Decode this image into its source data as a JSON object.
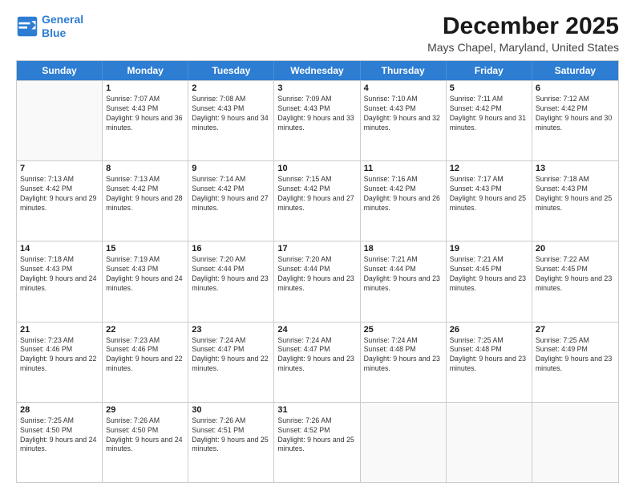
{
  "header": {
    "logo_line1": "General",
    "logo_line2": "Blue",
    "title": "December 2025",
    "subtitle": "Mays Chapel, Maryland, United States"
  },
  "calendar": {
    "days": [
      "Sunday",
      "Monday",
      "Tuesday",
      "Wednesday",
      "Thursday",
      "Friday",
      "Saturday"
    ],
    "rows": [
      [
        {
          "date": "",
          "sunrise": "",
          "sunset": "",
          "daylight": "",
          "empty": true
        },
        {
          "date": "1",
          "sunrise": "Sunrise: 7:07 AM",
          "sunset": "Sunset: 4:43 PM",
          "daylight": "Daylight: 9 hours and 36 minutes.",
          "empty": false
        },
        {
          "date": "2",
          "sunrise": "Sunrise: 7:08 AM",
          "sunset": "Sunset: 4:43 PM",
          "daylight": "Daylight: 9 hours and 34 minutes.",
          "empty": false
        },
        {
          "date": "3",
          "sunrise": "Sunrise: 7:09 AM",
          "sunset": "Sunset: 4:43 PM",
          "daylight": "Daylight: 9 hours and 33 minutes.",
          "empty": false
        },
        {
          "date": "4",
          "sunrise": "Sunrise: 7:10 AM",
          "sunset": "Sunset: 4:43 PM",
          "daylight": "Daylight: 9 hours and 32 minutes.",
          "empty": false
        },
        {
          "date": "5",
          "sunrise": "Sunrise: 7:11 AM",
          "sunset": "Sunset: 4:42 PM",
          "daylight": "Daylight: 9 hours and 31 minutes.",
          "empty": false
        },
        {
          "date": "6",
          "sunrise": "Sunrise: 7:12 AM",
          "sunset": "Sunset: 4:42 PM",
          "daylight": "Daylight: 9 hours and 30 minutes.",
          "empty": false
        }
      ],
      [
        {
          "date": "7",
          "sunrise": "Sunrise: 7:13 AM",
          "sunset": "Sunset: 4:42 PM",
          "daylight": "Daylight: 9 hours and 29 minutes.",
          "empty": false
        },
        {
          "date": "8",
          "sunrise": "Sunrise: 7:13 AM",
          "sunset": "Sunset: 4:42 PM",
          "daylight": "Daylight: 9 hours and 28 minutes.",
          "empty": false
        },
        {
          "date": "9",
          "sunrise": "Sunrise: 7:14 AM",
          "sunset": "Sunset: 4:42 PM",
          "daylight": "Daylight: 9 hours and 27 minutes.",
          "empty": false
        },
        {
          "date": "10",
          "sunrise": "Sunrise: 7:15 AM",
          "sunset": "Sunset: 4:42 PM",
          "daylight": "Daylight: 9 hours and 27 minutes.",
          "empty": false
        },
        {
          "date": "11",
          "sunrise": "Sunrise: 7:16 AM",
          "sunset": "Sunset: 4:42 PM",
          "daylight": "Daylight: 9 hours and 26 minutes.",
          "empty": false
        },
        {
          "date": "12",
          "sunrise": "Sunrise: 7:17 AM",
          "sunset": "Sunset: 4:43 PM",
          "daylight": "Daylight: 9 hours and 25 minutes.",
          "empty": false
        },
        {
          "date": "13",
          "sunrise": "Sunrise: 7:18 AM",
          "sunset": "Sunset: 4:43 PM",
          "daylight": "Daylight: 9 hours and 25 minutes.",
          "empty": false
        }
      ],
      [
        {
          "date": "14",
          "sunrise": "Sunrise: 7:18 AM",
          "sunset": "Sunset: 4:43 PM",
          "daylight": "Daylight: 9 hours and 24 minutes.",
          "empty": false
        },
        {
          "date": "15",
          "sunrise": "Sunrise: 7:19 AM",
          "sunset": "Sunset: 4:43 PM",
          "daylight": "Daylight: 9 hours and 24 minutes.",
          "empty": false
        },
        {
          "date": "16",
          "sunrise": "Sunrise: 7:20 AM",
          "sunset": "Sunset: 4:44 PM",
          "daylight": "Daylight: 9 hours and 23 minutes.",
          "empty": false
        },
        {
          "date": "17",
          "sunrise": "Sunrise: 7:20 AM",
          "sunset": "Sunset: 4:44 PM",
          "daylight": "Daylight: 9 hours and 23 minutes.",
          "empty": false
        },
        {
          "date": "18",
          "sunrise": "Sunrise: 7:21 AM",
          "sunset": "Sunset: 4:44 PM",
          "daylight": "Daylight: 9 hours and 23 minutes.",
          "empty": false
        },
        {
          "date": "19",
          "sunrise": "Sunrise: 7:21 AM",
          "sunset": "Sunset: 4:45 PM",
          "daylight": "Daylight: 9 hours and 23 minutes.",
          "empty": false
        },
        {
          "date": "20",
          "sunrise": "Sunrise: 7:22 AM",
          "sunset": "Sunset: 4:45 PM",
          "daylight": "Daylight: 9 hours and 23 minutes.",
          "empty": false
        }
      ],
      [
        {
          "date": "21",
          "sunrise": "Sunrise: 7:23 AM",
          "sunset": "Sunset: 4:46 PM",
          "daylight": "Daylight: 9 hours and 22 minutes.",
          "empty": false
        },
        {
          "date": "22",
          "sunrise": "Sunrise: 7:23 AM",
          "sunset": "Sunset: 4:46 PM",
          "daylight": "Daylight: 9 hours and 22 minutes.",
          "empty": false
        },
        {
          "date": "23",
          "sunrise": "Sunrise: 7:24 AM",
          "sunset": "Sunset: 4:47 PM",
          "daylight": "Daylight: 9 hours and 22 minutes.",
          "empty": false
        },
        {
          "date": "24",
          "sunrise": "Sunrise: 7:24 AM",
          "sunset": "Sunset: 4:47 PM",
          "daylight": "Daylight: 9 hours and 23 minutes.",
          "empty": false
        },
        {
          "date": "25",
          "sunrise": "Sunrise: 7:24 AM",
          "sunset": "Sunset: 4:48 PM",
          "daylight": "Daylight: 9 hours and 23 minutes.",
          "empty": false
        },
        {
          "date": "26",
          "sunrise": "Sunrise: 7:25 AM",
          "sunset": "Sunset: 4:48 PM",
          "daylight": "Daylight: 9 hours and 23 minutes.",
          "empty": false
        },
        {
          "date": "27",
          "sunrise": "Sunrise: 7:25 AM",
          "sunset": "Sunset: 4:49 PM",
          "daylight": "Daylight: 9 hours and 23 minutes.",
          "empty": false
        }
      ],
      [
        {
          "date": "28",
          "sunrise": "Sunrise: 7:25 AM",
          "sunset": "Sunset: 4:50 PM",
          "daylight": "Daylight: 9 hours and 24 minutes.",
          "empty": false
        },
        {
          "date": "29",
          "sunrise": "Sunrise: 7:26 AM",
          "sunset": "Sunset: 4:50 PM",
          "daylight": "Daylight: 9 hours and 24 minutes.",
          "empty": false
        },
        {
          "date": "30",
          "sunrise": "Sunrise: 7:26 AM",
          "sunset": "Sunset: 4:51 PM",
          "daylight": "Daylight: 9 hours and 25 minutes.",
          "empty": false
        },
        {
          "date": "31",
          "sunrise": "Sunrise: 7:26 AM",
          "sunset": "Sunset: 4:52 PM",
          "daylight": "Daylight: 9 hours and 25 minutes.",
          "empty": false
        },
        {
          "date": "",
          "sunrise": "",
          "sunset": "",
          "daylight": "",
          "empty": true
        },
        {
          "date": "",
          "sunrise": "",
          "sunset": "",
          "daylight": "",
          "empty": true
        },
        {
          "date": "",
          "sunrise": "",
          "sunset": "",
          "daylight": "",
          "empty": true
        }
      ]
    ]
  }
}
